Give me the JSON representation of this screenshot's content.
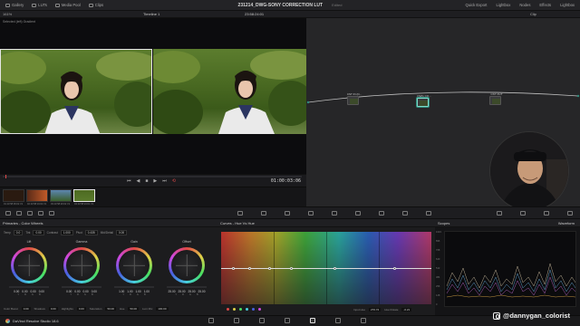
{
  "topbar": {
    "left_tabs": [
      {
        "label": "Gallery",
        "icon": "gallery-icon"
      },
      {
        "label": "LUTs",
        "icon": "luts-icon"
      },
      {
        "label": "Media Pool",
        "icon": "media-pool-icon"
      },
      {
        "label": "Clips",
        "icon": "clips-icon"
      }
    ],
    "project_title": "231214_DWG-SONY CORRECTION LUT",
    "edited_label": "Edited",
    "right_tabs": [
      {
        "label": "Quick Export",
        "icon": "export-icon"
      },
      {
        "label": "Lightbox",
        "icon": "lightbox-icon"
      },
      {
        "label": "Nodes",
        "icon": "nodes-icon"
      },
      {
        "label": "Effects",
        "icon": "effects-icon"
      },
      {
        "label": "Lightbox",
        "icon": "lightbox-icon"
      }
    ]
  },
  "subbar": {
    "zoom": "161%",
    "timeline_name": "Timeline 1",
    "timecode": "23:58:24:01",
    "clip_mode": "Clip"
  },
  "viewer": {
    "label": "Selected (left) Gradient"
  },
  "transport": {
    "timecode": "01:00:03:06"
  },
  "thumbnails": [
    {
      "caption": "01  23:58:06:02  V1"
    },
    {
      "caption": "02  23:58:19:02  V1"
    },
    {
      "caption": "03  23:58:20:02  V1"
    },
    {
      "caption": "04  23:58:24:01  V1"
    }
  ],
  "nodes": [
    {
      "label": "CST IN (D..."
    },
    {
      "label": "DWG CO..."
    },
    {
      "label": "CST OUT"
    }
  ],
  "primaries": {
    "title": "Primaries - Color Wheels",
    "row1": [
      {
        "label": "Temp",
        "value": "0.0"
      },
      {
        "label": "Tint",
        "value": "0.00"
      },
      {
        "label": "Contrast",
        "value": "1.000"
      },
      {
        "label": "Pivot",
        "value": "0.435"
      },
      {
        "label": "Mid/Detail",
        "value": "0.00"
      }
    ],
    "wheels": [
      {
        "name": "Lift",
        "values": [
          "0.00",
          "0.00",
          "0.00",
          "0.00"
        ]
      },
      {
        "name": "Gamma",
        "values": [
          "0.00",
          "0.00",
          "0.00",
          "0.00"
        ]
      },
      {
        "name": "Gain",
        "values": [
          "1.00",
          "1.00",
          "1.00",
          "1.00"
        ]
      },
      {
        "name": "Offset",
        "values": [
          "25.00",
          "25.00",
          "25.00",
          "25.00"
        ]
      }
    ],
    "channel_labels": [
      "Y",
      "R",
      "G",
      "B"
    ],
    "row2": [
      {
        "label": "Color Boost",
        "value": "0.00"
      },
      {
        "label": "Shadows",
        "value": "0.00"
      },
      {
        "label": "Highlights",
        "value": "0.00"
      },
      {
        "label": "Saturation",
        "value": "50.00"
      },
      {
        "label": "Hue",
        "value": "50.00"
      },
      {
        "label": "Lum Mix",
        "value": "100.00"
      }
    ]
  },
  "curves": {
    "title": "Curves - Hue Vs Hue",
    "input_hue_label": "Input Hue",
    "input_hue": "270.72",
    "hue_rotate_label": "Hue Rotate",
    "hue_rotate": "-0.21"
  },
  "scopes": {
    "title": "Scopes",
    "mode": "Waveform",
    "scale": [
      "1023",
      "896",
      "768",
      "640",
      "512",
      "384",
      "256",
      "128",
      "0"
    ]
  },
  "statusbar": {
    "app_name": "DaVinci Resolve Studio 18.6"
  },
  "watermark": {
    "handle": "@dannygan_colorist"
  },
  "colors": {
    "accent_selected_node": "#7fd8c8",
    "playhead": "#e04848"
  }
}
